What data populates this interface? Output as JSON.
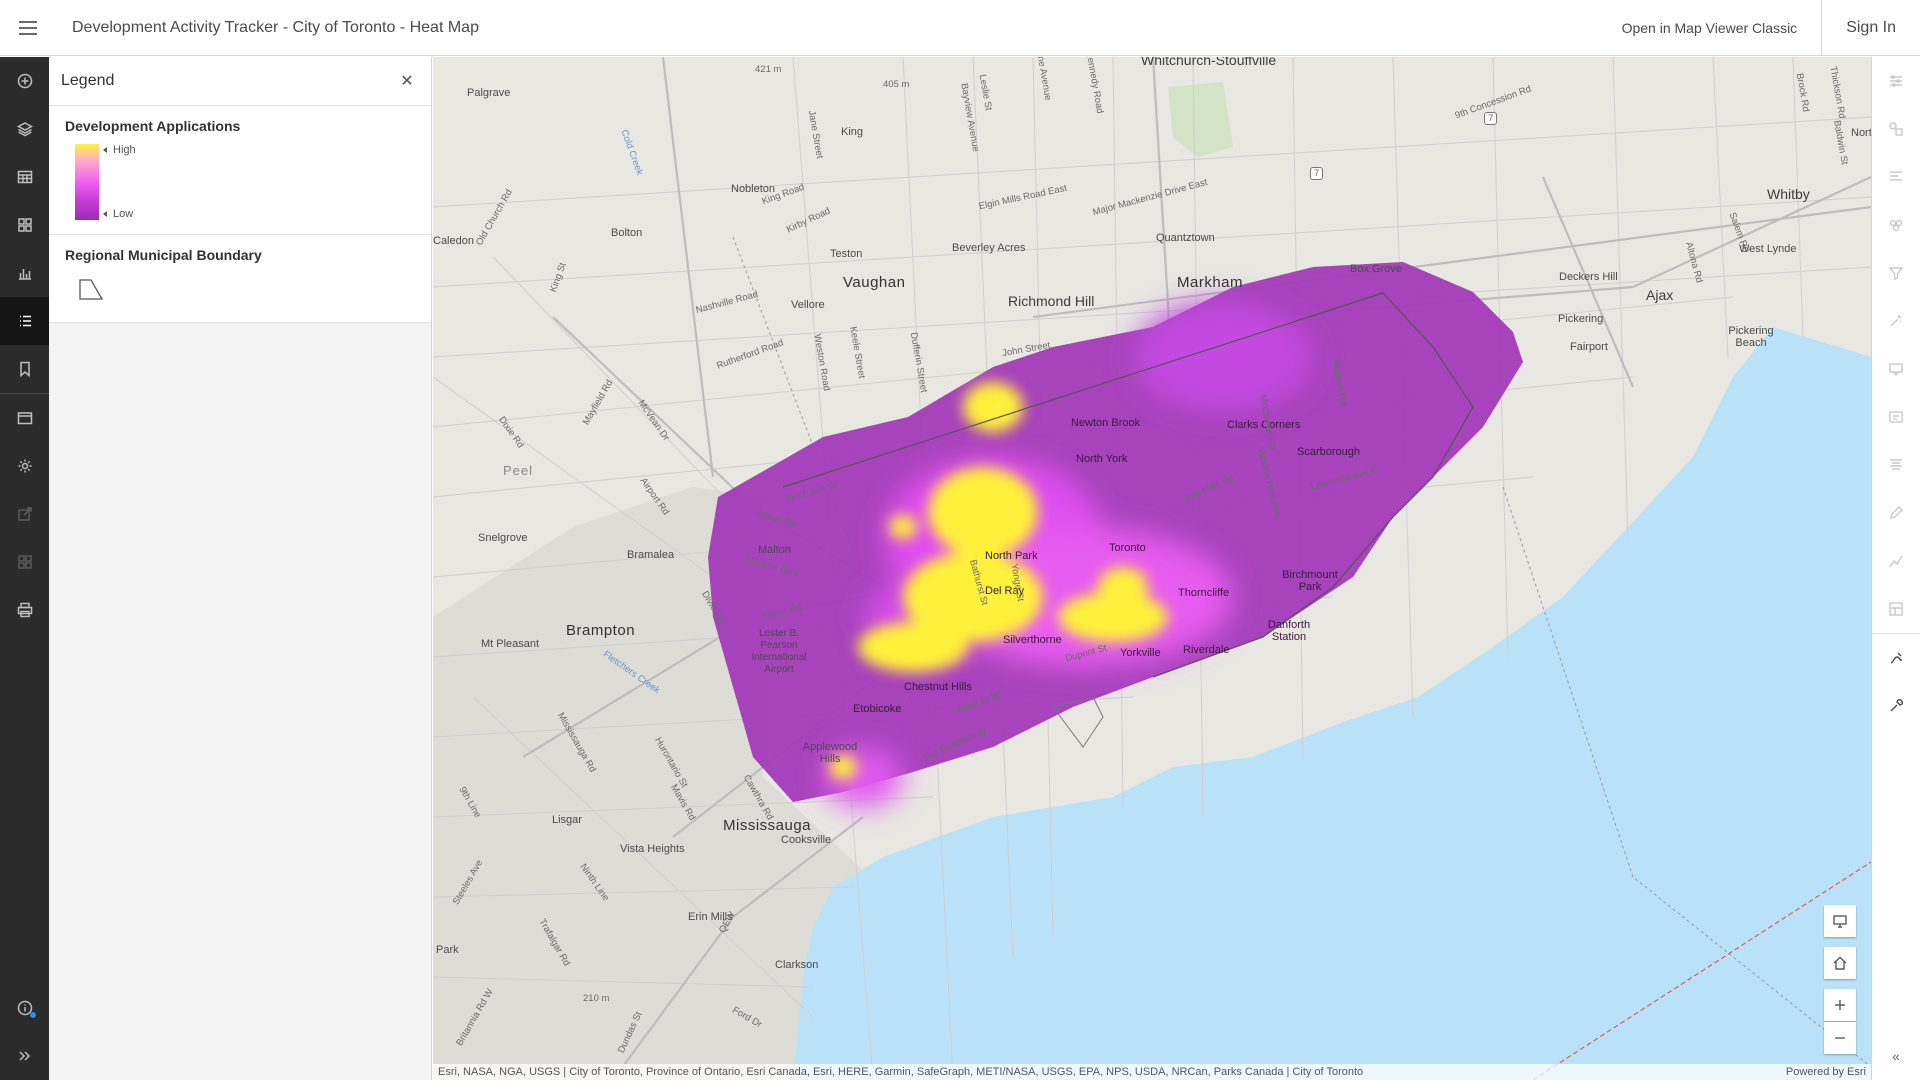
{
  "header": {
    "title": "Development Activity Tracker - City of Toronto - Heat Map",
    "open_classic": "Open in Map Viewer Classic",
    "sign_in": "Sign In"
  },
  "panel": {
    "title": "Legend",
    "layers": [
      {
        "name": "Development Applications",
        "high": "High",
        "low": "Low"
      },
      {
        "name": "Regional Municipal Boundary"
      }
    ]
  },
  "map": {
    "places": [
      "Whitchurch-Stouffville",
      "Palgrave",
      "King",
      "Nobleton",
      "Bolton",
      "Caledon",
      "Vaughan",
      "Teston",
      "Vellore",
      "Beverley Acres",
      "Richmond Hill",
      "Markham",
      "Quantztown",
      "Box Grove",
      "Whitby",
      "Deckers Hill",
      "Ajax",
      "West Lynde",
      "Pickering",
      "Fairport",
      "Pickering Beach",
      "Newton Brook",
      "North York",
      "Clarks Corners",
      "Scarborough",
      "Peel",
      "Snelgrove",
      "Bramalea",
      "Malton",
      "North Park",
      "Toronto",
      "Del Ray",
      "Birchmount Park",
      "Thorncliffe",
      "Danforth Station",
      "Brampton",
      "Mt Pleasant",
      "Lester B. Pearson International Airport",
      "Silverthorne",
      "Yorkville",
      "Riverdale",
      "Chestnut Hills",
      "Etobicoke",
      "Applewood Hills",
      "Mississauga",
      "Cooksville",
      "Lisgar",
      "Vista Heights",
      "Erin Mills",
      "Clarkson",
      "Park",
      "North"
    ],
    "roads": [
      "King Road",
      "Kirby Road",
      "Nashville Road",
      "Rutherford Road",
      "Elgin Mills Road East",
      "Major Mackenzie Drive East",
      "John Street",
      "Finch Ave W",
      "Albion Rd",
      "Rexdale Blvd",
      "Dixon Rd",
      "Lawrence Ave E",
      "York Mills Rd",
      "Bathurst St",
      "Yonge St",
      "Dupont St",
      "The Queensway",
      "Bloor St W",
      "Dixie Rd",
      "Airport Rd",
      "Mayfield Rd",
      "McVean Dr",
      "Old Church Rd",
      "King St",
      "Jane Street",
      "Keele Street",
      "Dufferin Street",
      "Weston Road",
      "Hurontario St",
      "Mavis Rd",
      "Cawthra Rd",
      "Mississauga Rd",
      "9th Line",
      "Steeles Ave",
      "Trafalgar Rd",
      "Britannia Rd W",
      "QEW",
      "Dundas St",
      "Ford Dr",
      "Ninth Line",
      "Divie Rd",
      "Fletchers Creek",
      "Cold Creek",
      "9th Concession Rd",
      "Salem Rd",
      "Brock Rd",
      "Altona Rd",
      "Thickson Rd",
      "Baldwin St",
      "Leslie St",
      "Woodbine Avenue",
      "Kennedy Road",
      "Bayview Avenue",
      "McCowan Rd",
      "Neilson Rd",
      "Victoria Park Ave"
    ],
    "spots": [
      "421 m",
      "405 m",
      "210 m"
    ],
    "highway": "7",
    "attribution": "Esri, NASA, NGA, USGS | City of Toronto, Province of Ontario, Esri Canada, Esri, HERE, Garmin, SafeGraph, METI/NASA, USGS, EPA, NPS, USDA, NRCan, Parks Canada | City of Toronto",
    "powered_by": "Powered by Esri"
  }
}
